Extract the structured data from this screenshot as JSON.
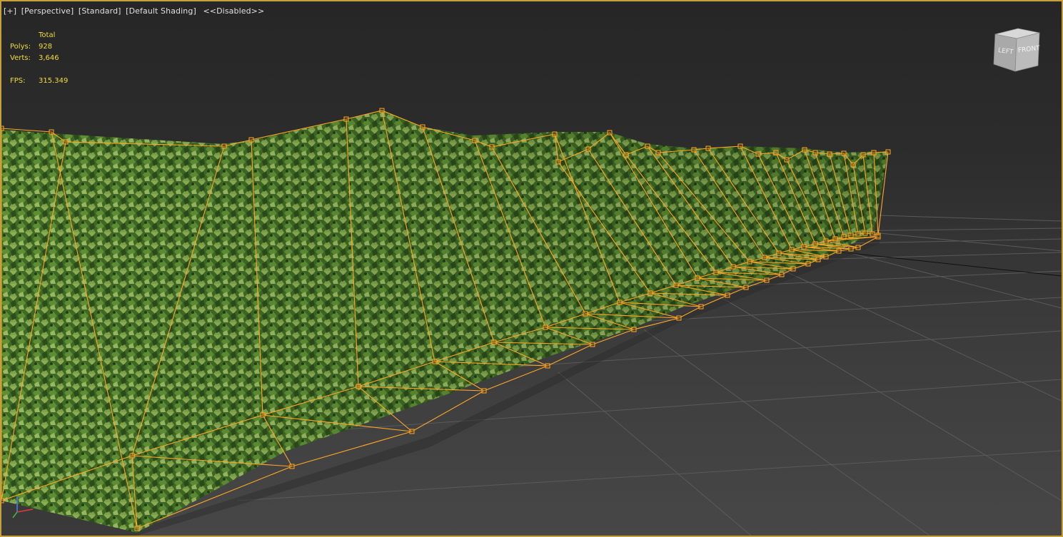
{
  "viewport": {
    "labels": {
      "plus": "[+]",
      "view": "[Perspective]",
      "style": "[Standard]",
      "shading": "[Default Shading]",
      "disabled": "<<Disabled>>"
    }
  },
  "stats": {
    "header": "Total",
    "polys_label": "Polys:",
    "polys_value": "928",
    "verts_label": "Verts:",
    "verts_value": "3,646",
    "fps_label": "FPS:",
    "fps_value": "315.349"
  },
  "viewcube": {
    "left_label": "LEFT",
    "front_label": "FRONT"
  },
  "colors": {
    "selection_border": "#c8a03a",
    "wireframe": "#ffa726",
    "stats_text": "#f0dc3c",
    "foliage_dark": "#2e4f1d",
    "foliage_mid": "#4f7d2c",
    "foliage_light": "#8fae57"
  }
}
